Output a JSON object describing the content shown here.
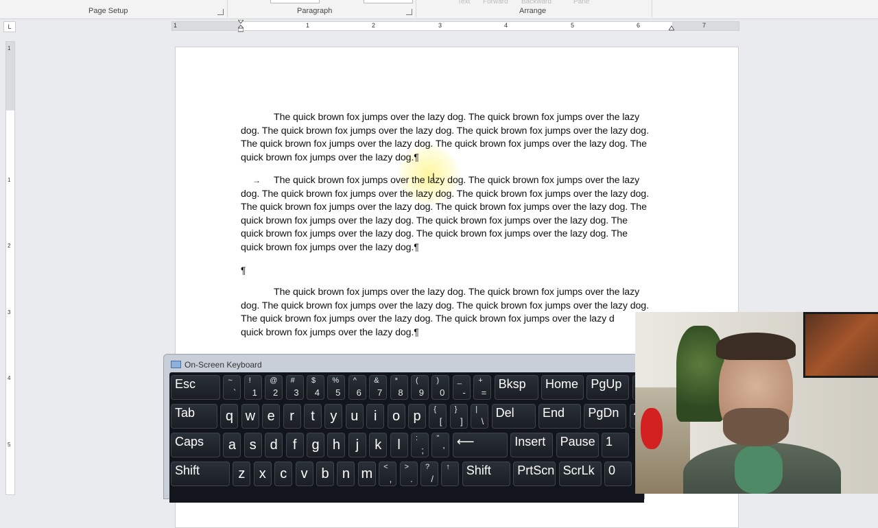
{
  "ribbon": {
    "groups": [
      {
        "label": "Page Setup"
      },
      {
        "label": "Paragraph"
      },
      {
        "label": "Arrange"
      }
    ],
    "faded_labels": [
      "Text",
      "Forward",
      "Backward",
      "Pane"
    ]
  },
  "ruler": {
    "tab_selector": "L",
    "h_numbers": [
      "1",
      "1",
      "2",
      "3",
      "4",
      "5",
      "6",
      "7"
    ],
    "v_numbers": [
      "1",
      "1",
      "2",
      "3",
      "4",
      "5"
    ]
  },
  "document": {
    "para1": [
      "The quick brown fox jumps over the lazy dog. The quick brown fox jumps over the lazy",
      "dog. The quick brown fox jumps over the lazy dog. The quick brown fox jumps over the lazy dog.",
      "The quick brown fox jumps over the lazy dog. The quick brown fox jumps over the lazy dog. The",
      "quick brown fox jumps over the lazy dog.¶"
    ],
    "para2_tab": "→",
    "para2": [
      "The quick brown fox jumps over the lazy dog. The quick brown fox jumps over the lazy",
      "dog. The quick brown fox jumps over the lazy dog. The quick brown fox jumps over the lazy dog.",
      "The quick brown fox jumps over the lazy dog. The quick brown fox jumps over the lazy dog. The",
      "quick brown fox jumps over the lazy dog. The quick brown fox jumps over the lazy dog. The",
      "quick brown fox jumps over the lazy dog. The quick brown fox jumps over the lazy dog. The",
      "quick brown fox jumps over the lazy dog.¶"
    ],
    "empty_para": "¶",
    "para3": [
      "The quick brown fox jumps over the lazy dog. The quick brown fox jumps over the lazy",
      "dog. The quick brown fox jumps over the lazy dog. The quick brown fox jumps over the lazy dog.",
      "The quick brown fox jumps over the lazy dog. The quick brown fox jumps over the lazy d",
      "quick brown fox jumps over the lazy dog.¶"
    ],
    "cursor": "I"
  },
  "osk": {
    "title": "On-Screen Keyboard",
    "rows": [
      [
        {
          "main": "Esc"
        },
        {
          "top": "~",
          "bot": "`"
        },
        {
          "top": "!",
          "bot": "1"
        },
        {
          "top": "@",
          "bot": "2"
        },
        {
          "top": "#",
          "bot": "3"
        },
        {
          "top": "$",
          "bot": "4"
        },
        {
          "top": "%",
          "bot": "5"
        },
        {
          "top": "^",
          "bot": "6"
        },
        {
          "top": "&",
          "bot": "7"
        },
        {
          "top": "*",
          "bot": "8"
        },
        {
          "top": "(",
          "bot": "9"
        },
        {
          "top": ")",
          "bot": "0"
        },
        {
          "top": "_",
          "bot": "-"
        },
        {
          "top": "+",
          "bot": "="
        },
        {
          "main": "Bksp"
        },
        {
          "main": "Home"
        },
        {
          "main": "PgUp"
        },
        {
          "main": "7"
        }
      ],
      [
        {
          "main": "Tab"
        },
        {
          "letter": "q"
        },
        {
          "letter": "w"
        },
        {
          "letter": "e"
        },
        {
          "letter": "r"
        },
        {
          "letter": "t"
        },
        {
          "letter": "y"
        },
        {
          "letter": "u"
        },
        {
          "letter": "i"
        },
        {
          "letter": "o"
        },
        {
          "letter": "p"
        },
        {
          "top": "{",
          "bot": "["
        },
        {
          "top": "}",
          "bot": "]"
        },
        {
          "top": "|",
          "bot": "\\"
        },
        {
          "main": "Del"
        },
        {
          "main": "End"
        },
        {
          "main": "PgDn"
        },
        {
          "main": "4"
        }
      ],
      [
        {
          "main": "Caps"
        },
        {
          "letter": "a"
        },
        {
          "letter": "s"
        },
        {
          "letter": "d"
        },
        {
          "letter": "f"
        },
        {
          "letter": "g"
        },
        {
          "letter": "h"
        },
        {
          "letter": "j"
        },
        {
          "letter": "k"
        },
        {
          "letter": "l"
        },
        {
          "top": ":",
          "bot": ";"
        },
        {
          "top": "\"",
          "bot": "'"
        },
        {
          "main": "⟵"
        },
        {
          "main": "Insert"
        },
        {
          "main": "Pause"
        },
        {
          "main": "1"
        }
      ],
      [
        {
          "main": "Shift"
        },
        {
          "letter": "z"
        },
        {
          "letter": "x"
        },
        {
          "letter": "c"
        },
        {
          "letter": "v"
        },
        {
          "letter": "b"
        },
        {
          "letter": "n"
        },
        {
          "letter": "m"
        },
        {
          "top": "<",
          "bot": ","
        },
        {
          "top": ">",
          "bot": "."
        },
        {
          "top": "?",
          "bot": "/"
        },
        {
          "top": "↑",
          "bot": ""
        },
        {
          "main": "Shift"
        },
        {
          "main": "PrtScn"
        },
        {
          "main": "ScrLk"
        },
        {
          "main": "0"
        }
      ]
    ]
  }
}
